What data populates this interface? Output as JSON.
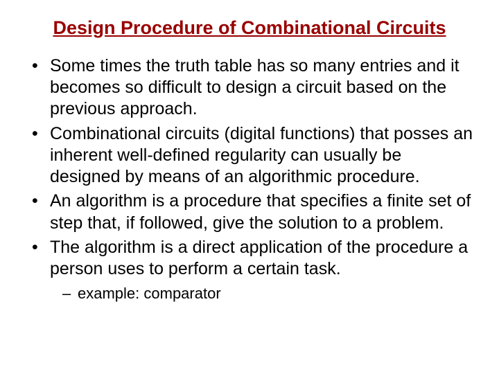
{
  "title": "Design Procedure of Combinational Circuits",
  "bullets": [
    "Some times the truth table has so many entries and it becomes so difficult to design a circuit based on the previous approach.",
    "Combinational circuits (digital functions) that posses an inherent well-defined regularity can usually be designed by means of an algorithmic procedure.",
    "An algorithm is a procedure that specifies a finite set of step that, if followed, give the solution to a problem.",
    "The algorithm is a direct application of the procedure a person uses to perform a certain task."
  ],
  "sub_bullet": "example: comparator"
}
